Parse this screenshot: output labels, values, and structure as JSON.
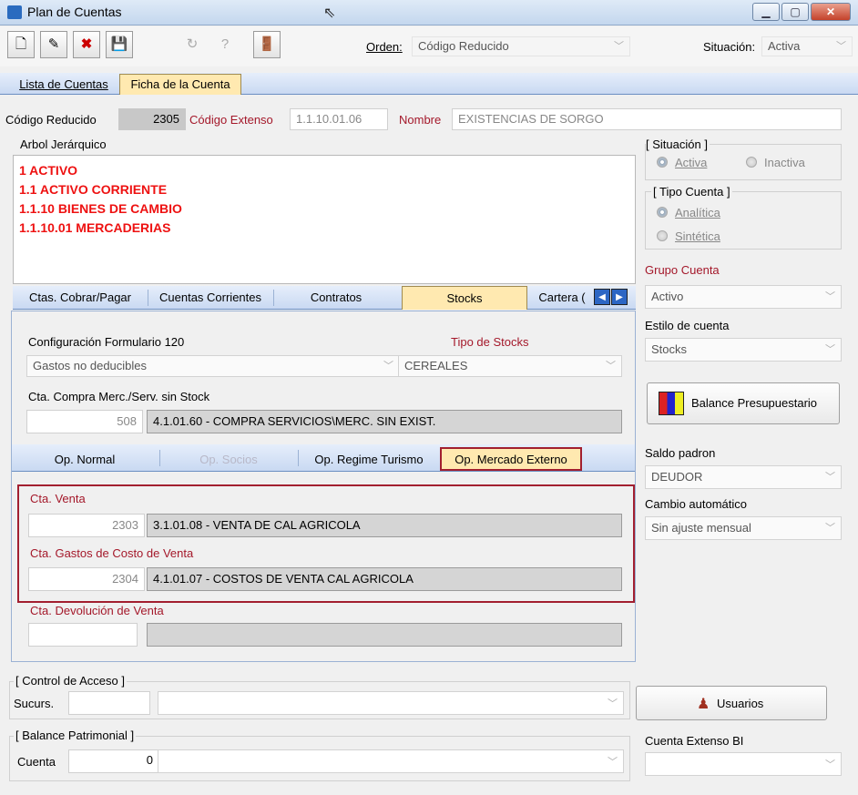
{
  "window": {
    "title": "Plan de Cuentas"
  },
  "toolbar": {
    "orden_label": "Orden:",
    "orden_value": "Código Reducido",
    "situacion_label": "Situación:",
    "situacion_value": "Activa"
  },
  "main_tabs": [
    {
      "label": "Lista de Cuentas"
    },
    {
      "label": "Ficha de la Cuenta"
    }
  ],
  "header": {
    "codigo_reducido_label": "Código Reducido",
    "codigo_reducido_value": "2305",
    "codigo_extenso_label": "Código Extenso",
    "codigo_extenso_value": "1.1.10.01.06",
    "nombre_label": "Nombre",
    "nombre_value": "EXISTENCIAS DE SORGO"
  },
  "arbol": {
    "label": "Arbol Jerárquico",
    "lines": [
      "1  ACTIVO",
      "1.1  ACTIVO CORRIENTE",
      "1.1.10  BIENES DE CAMBIO",
      "1.1.10.01  MERCADERIAS"
    ]
  },
  "sub_tabs": [
    {
      "label": "Ctas. Cobrar/Pagar"
    },
    {
      "label": "Cuentas Corrientes"
    },
    {
      "label": "Contratos"
    },
    {
      "label": "Stocks"
    },
    {
      "label": "Cartera ("
    }
  ],
  "stocks": {
    "config_label": "Configuración Formulario 120",
    "config_value": "Gastos no deducibles",
    "tipo_label": "Tipo de Stocks",
    "tipo_value": "CEREALES",
    "compra_label": "Cta. Compra Merc./Serv. sin Stock",
    "compra_code": "508",
    "compra_desc": "4.1.01.60 - COMPRA SERVICIOS\\MERC. SIN EXIST."
  },
  "op_tabs": [
    {
      "label": "Op. Normal"
    },
    {
      "label": "Op. Socios"
    },
    {
      "label": "Op. Regime Turismo"
    },
    {
      "label": "Op. Mercado Externo"
    }
  ],
  "op_panel": {
    "venta_label": "Cta. Venta",
    "venta_code": "2303",
    "venta_desc": "3.1.01.08 - VENTA DE CAL AGRICOLA",
    "gastos_label": "Cta. Gastos de Costo de Venta",
    "gastos_code": "2304",
    "gastos_desc": "4.1.01.07 - COSTOS DE VENTA CAL AGRICOLA",
    "devol_label": "Cta. Devolución de Venta",
    "devol_code": "",
    "devol_desc": ""
  },
  "right_panel": {
    "situacion_group": "[ Situación ]",
    "activa": "Activa",
    "inactiva": "Inactiva",
    "tipo_group": "[ Tipo Cuenta ]",
    "analitica": "Analítica",
    "sintetica": "Sintética",
    "grupo_label": "Grupo Cuenta",
    "grupo_value": "Activo",
    "estilo_label": "Estilo de cuenta",
    "estilo_value": "Stocks",
    "balance_button": "Balance Presupuestario",
    "saldo_label": "Saldo padron",
    "saldo_value": "DEUDOR",
    "cambio_label": "Cambio automático",
    "cambio_value": "Sin ajuste mensual"
  },
  "control_acceso": {
    "group": "[ Control de Acceso ]",
    "sucurs_label": "Sucurs.",
    "sucurs_value": "",
    "combo_value": "",
    "usuarios_button": "Usuarios"
  },
  "balance_patrimonial": {
    "group": "[ Balance Patrimonial ]",
    "cuenta_label": "Cuenta",
    "cuenta_value": "0",
    "combo_value": ""
  },
  "cuenta_extenso_bi": {
    "label": "Cuenta Extenso BI",
    "value": ""
  },
  "colors": {
    "accent_red": "#a4182a",
    "highlight_border": "#a21f2f",
    "tab_active": "#ffe9b0"
  }
}
